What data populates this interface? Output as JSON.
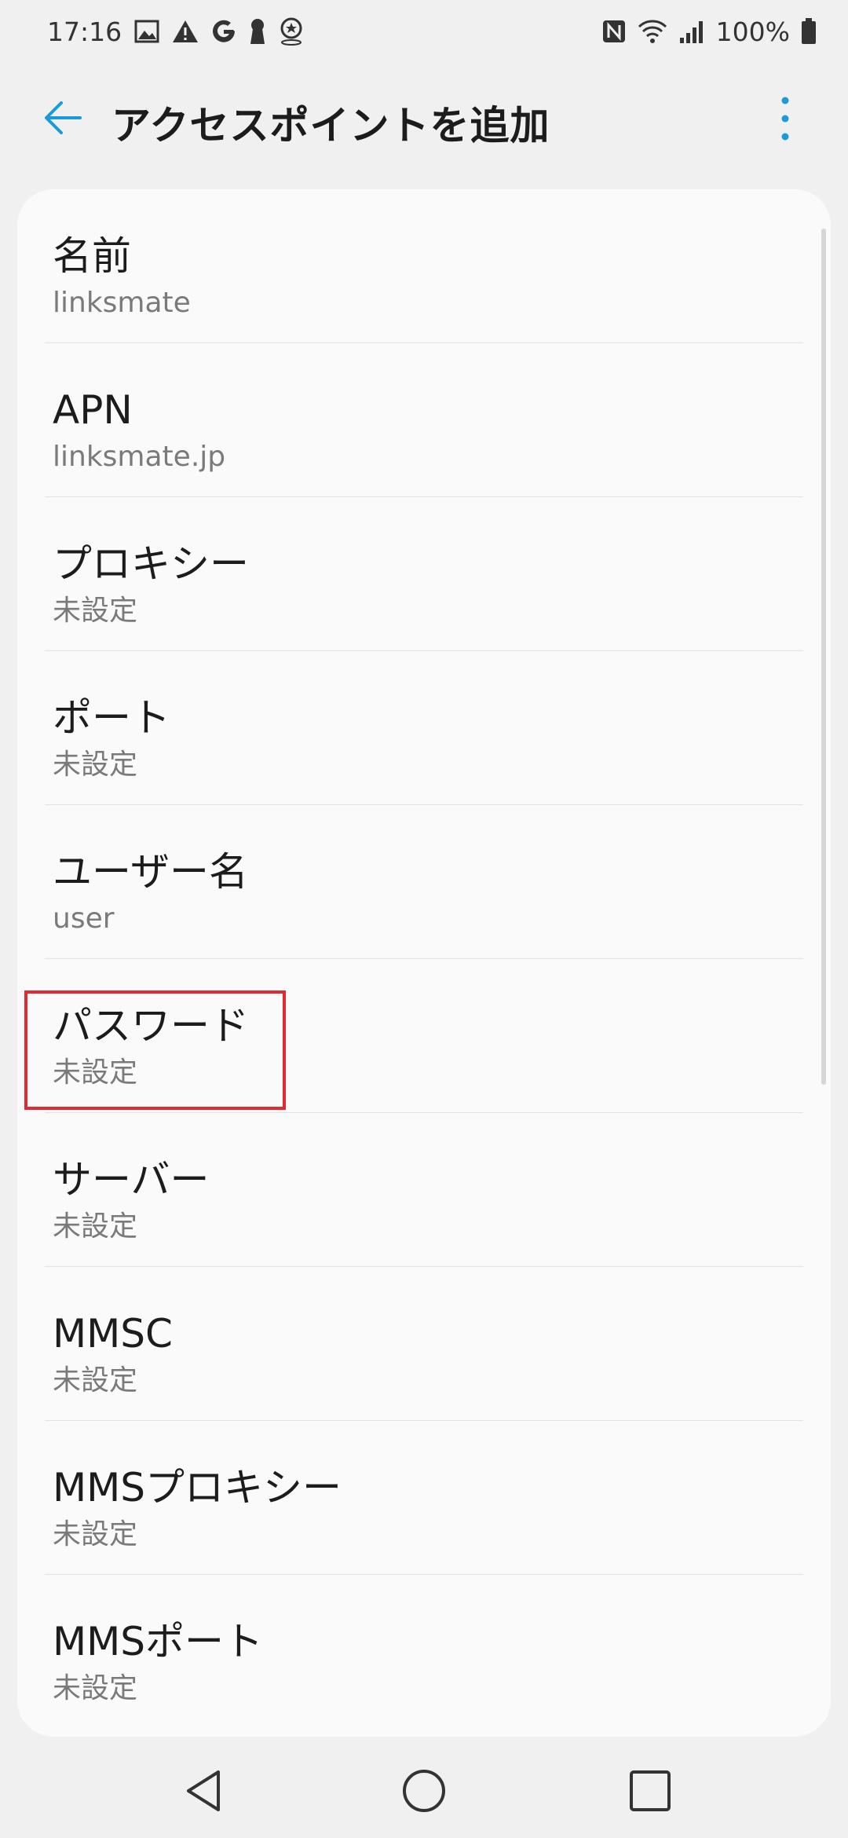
{
  "status_bar": {
    "time": "17:16",
    "battery_text": "100%",
    "left_icons": [
      "image-icon",
      "warning-icon",
      "google-icon",
      "keyhole-icon",
      "location-badge-icon"
    ],
    "right_icons": [
      "nfc-icon",
      "wifi-icon",
      "signal-icon",
      "battery-icon"
    ]
  },
  "app_bar": {
    "title": "アクセスポイントを追加",
    "back_icon": "arrow-left-icon",
    "more_icon": "more-vert-icon",
    "accent_color": "#1a9ad6"
  },
  "settings": {
    "items": [
      {
        "title": "名前",
        "value": "linksmate"
      },
      {
        "title": "APN",
        "value": "linksmate.jp"
      },
      {
        "title": "プロキシー",
        "value": "未設定"
      },
      {
        "title": "ポート",
        "value": "未設定"
      },
      {
        "title": "ユーザー名",
        "value": "user"
      },
      {
        "title": "パスワード",
        "value": "未設定"
      },
      {
        "title": "サーバー",
        "value": "未設定"
      },
      {
        "title": "MMSC",
        "value": "未設定"
      },
      {
        "title": "MMSプロキシー",
        "value": "未設定"
      },
      {
        "title": "MMSポート",
        "value": "未設定"
      }
    ],
    "highlighted_item": "パスワード",
    "highlight_color": "#e02a32"
  },
  "nav_bar": {
    "icons": [
      "nav-back-icon",
      "nav-home-icon",
      "nav-recents-icon"
    ]
  }
}
